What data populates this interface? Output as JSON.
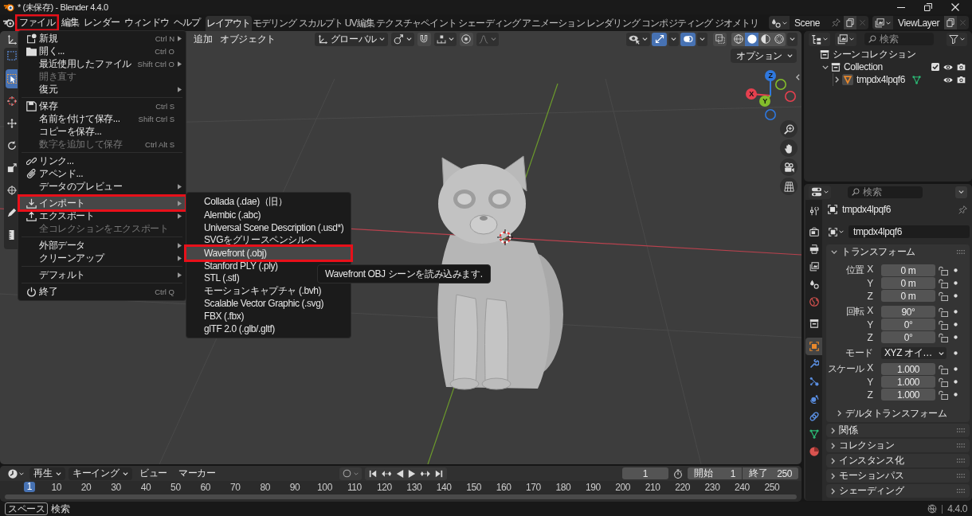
{
  "window": {
    "title": "* (未保存) - Blender 4.4.0"
  },
  "menubar": [
    {
      "label": "ファイル",
      "highlighted": true
    },
    {
      "label": "編集",
      "highlighted": false
    },
    {
      "label": "レンダー",
      "highlighted": false
    },
    {
      "label": "ウィンドウ",
      "highlighted": false
    },
    {
      "label": "ヘルプ",
      "highlighted": false
    }
  ],
  "workspace_tabs": [
    {
      "label": "レイアウト",
      "selected": true
    },
    {
      "label": "モデリング",
      "selected": false
    },
    {
      "label": "スカルプト",
      "selected": false
    },
    {
      "label": "UV編集",
      "selected": false
    },
    {
      "label": "テクスチャペイント",
      "selected": false
    },
    {
      "label": "シェーディング",
      "selected": false
    },
    {
      "label": "アニメーション",
      "selected": false
    },
    {
      "label": "レンダリング",
      "selected": false
    },
    {
      "label": "コンポジティング",
      "selected": false
    },
    {
      "label": "ジオメトリ",
      "selected": false
    }
  ],
  "scene_selector": {
    "value": "Scene"
  },
  "view_layer_selector": {
    "value": "ViewLayer"
  },
  "viewport": {
    "menus": [
      "追加",
      "オブジェクト"
    ],
    "orientation": "グローバル",
    "gizmos": {
      "on": true
    },
    "overlays": {
      "on": true
    },
    "shading_modes": [
      {
        "selected": false
      },
      {
        "selected": true
      },
      {
        "selected": false
      },
      {
        "selected": false
      }
    ],
    "options": "オプション",
    "gizmo_axes": [
      {
        "label": "X",
        "color": "#e5404f"
      },
      {
        "label": "Y",
        "color": "#84bd2b"
      },
      {
        "label": "Z",
        "color": "#2f78de"
      }
    ],
    "tools": [
      {
        "selected": true
      },
      {
        "selected": false
      },
      {
        "selected": false
      },
      {
        "selected": false
      },
      {
        "selected": false
      },
      {
        "selected": false
      },
      {
        "selected": false
      },
      {
        "selected": false
      }
    ]
  },
  "file_menu": {
    "sections": [
      [
        {
          "label": "新規",
          "shortcut": "Ctrl N",
          "submenu": true,
          "disabled": false,
          "selected": false,
          "highlighted": false
        },
        {
          "label": "開く...",
          "shortcut": "Ctrl O",
          "submenu": false,
          "disabled": false,
          "selected": false,
          "highlighted": false
        },
        {
          "label": "最近使用したファイル",
          "shortcut": "Shift Ctrl O",
          "submenu": true,
          "disabled": false,
          "selected": false,
          "highlighted": false
        },
        {
          "label": "開き直す",
          "submenu": false,
          "disabled": true,
          "selected": false,
          "highlighted": false
        },
        {
          "label": "復元",
          "submenu": true,
          "disabled": false,
          "selected": false,
          "highlighted": false
        }
      ],
      [
        {
          "label": "保存",
          "shortcut": "Ctrl S",
          "submenu": false,
          "disabled": false,
          "selected": false,
          "highlighted": false
        },
        {
          "label": "名前を付けて保存...",
          "shortcut": "Shift Ctrl S",
          "submenu": false,
          "disabled": false,
          "selected": false,
          "highlighted": false
        },
        {
          "label": "コピーを保存...",
          "submenu": false,
          "disabled": false,
          "selected": false,
          "highlighted": false
        },
        {
          "label": "数字を追加して保存",
          "shortcut": "Ctrl Alt S",
          "submenu": false,
          "disabled": true,
          "selected": false,
          "highlighted": false
        }
      ],
      [
        {
          "label": "リンク...",
          "submenu": false,
          "disabled": false,
          "selected": false,
          "highlighted": false
        },
        {
          "label": "アペンド...",
          "submenu": false,
          "disabled": false,
          "selected": false,
          "highlighted": false
        },
        {
          "label": "データのプレビュー",
          "submenu": true,
          "disabled": false,
          "selected": false,
          "highlighted": false
        }
      ],
      [
        {
          "label": "インポート",
          "submenu": true,
          "disabled": false,
          "selected": true,
          "highlighted": true
        },
        {
          "label": "エクスポート",
          "submenu": true,
          "disabled": false,
          "selected": false,
          "highlighted": false
        },
        {
          "label": "全コレクションをエクスポート",
          "submenu": false,
          "disabled": true,
          "selected": false,
          "highlighted": false
        }
      ],
      [
        {
          "label": "外部データ",
          "submenu": true,
          "disabled": false,
          "selected": false,
          "highlighted": false
        },
        {
          "label": "クリーンアップ",
          "submenu": true,
          "disabled": false,
          "selected": false,
          "highlighted": false
        }
      ],
      [
        {
          "label": "デフォルト",
          "submenu": true,
          "disabled": false,
          "selected": false,
          "highlighted": false
        }
      ],
      [
        {
          "label": "終了",
          "shortcut": "Ctrl Q",
          "submenu": false,
          "disabled": false,
          "selected": false,
          "highlighted": false
        }
      ]
    ]
  },
  "import_menu": {
    "items": [
      {
        "label": "Collada (.dae)（旧）",
        "selected": false,
        "highlighted": false
      },
      {
        "label": "Alembic (.abc)",
        "selected": false,
        "highlighted": false
      },
      {
        "label": "Universal Scene Description (.usd*)",
        "selected": false,
        "highlighted": false
      },
      {
        "label": "SVGをグリースペンシルへ",
        "selected": false,
        "highlighted": false
      },
      {
        "label": "Wavefront (.obj)",
        "selected": true,
        "highlighted": true
      },
      {
        "label": "Stanford PLY (.ply)",
        "selected": false,
        "highlighted": false
      },
      {
        "label": "STL (.stl)",
        "selected": false,
        "highlighted": false
      },
      {
        "label": "モーションキャプチャ (.bvh)",
        "selected": false,
        "highlighted": false
      },
      {
        "label": "Scalable Vector Graphic (.svg)",
        "selected": false,
        "highlighted": false
      },
      {
        "label": "FBX (.fbx)",
        "selected": false,
        "highlighted": false
      },
      {
        "label": "glTF 2.0 (.glb/.gltf)",
        "selected": false,
        "highlighted": false
      }
    ]
  },
  "tooltip": {
    "text": "Wavefront OBJ シーンを読み込みます."
  },
  "outliner": {
    "search": {
      "placeholder": "検索"
    },
    "tree": [
      {
        "kind": "scene_collection",
        "label": "シーンコレクション",
        "children": [
          {
            "kind": "collection",
            "label": "Collection",
            "expanded": true,
            "checked": true,
            "children": [
              {
                "kind": "object",
                "label": "tmpdx4lpqf6",
                "expanded": false
              }
            ]
          }
        ]
      }
    ]
  },
  "properties": {
    "search": {
      "placeholder": "検索"
    },
    "tabs": [
      {
        "selected": false
      },
      {
        "selected": false
      },
      {
        "selected": false
      },
      {
        "selected": false
      },
      {
        "selected": false
      },
      {
        "selected": false
      },
      {
        "selected": false
      },
      {
        "selected": true
      },
      {
        "selected": false
      },
      {
        "selected": false
      },
      {
        "selected": false
      },
      {
        "selected": false
      },
      {
        "selected": false
      },
      {
        "selected": false
      }
    ],
    "object_name": "tmpdx4lpqf6",
    "name_field": "tmpdx4lpqf6",
    "panels": [
      {
        "label": "トランスフォーム",
        "expanded": true,
        "rows": [
          {
            "kind": "number",
            "label": "位置",
            "axis": "X",
            "value": "0 m",
            "locked": false
          },
          {
            "kind": "number",
            "axis": "Y",
            "value": "0 m",
            "locked": false
          },
          {
            "kind": "number",
            "axis": "Z",
            "value": "0 m",
            "locked": false
          },
          {
            "kind": "number",
            "label": "回転",
            "axis": "X",
            "value": "90°",
            "locked": false
          },
          {
            "kind": "number",
            "axis": "Y",
            "value": "0°",
            "locked": false
          },
          {
            "kind": "number",
            "axis": "Z",
            "value": "0°",
            "locked": false
          },
          {
            "kind": "dropdown",
            "label": "モード",
            "value": "XYZ オイ…"
          },
          {
            "kind": "number",
            "label": "スケール",
            "axis": "X",
            "value": "1.000",
            "locked": false
          },
          {
            "kind": "number",
            "axis": "Y",
            "value": "1.000",
            "locked": false
          },
          {
            "kind": "number",
            "axis": "Z",
            "value": "1.000",
            "locked": false
          }
        ],
        "subpanels": [
          {
            "label": "デルタトランスフォーム",
            "expanded": false
          }
        ]
      },
      {
        "label": "関係",
        "expanded": false
      },
      {
        "label": "コレクション",
        "expanded": false
      },
      {
        "label": "インスタンス化",
        "expanded": false
      },
      {
        "label": "モーションパス",
        "expanded": false
      },
      {
        "label": "シェーディング",
        "expanded": false
      }
    ]
  },
  "timeline": {
    "menus": [
      {
        "label": "再生",
        "dropdown": true
      },
      {
        "label": "キーイング",
        "dropdown": true
      },
      {
        "label": "ビュー",
        "dropdown": false
      },
      {
        "label": "マーカー",
        "dropdown": false
      }
    ],
    "auto_keying": {
      "on": false
    },
    "current_frame": "1",
    "start": {
      "label": "開始",
      "value": "1"
    },
    "end": {
      "label": "終了",
      "value": "250"
    },
    "ruler": [
      {
        "label": "1",
        "selected": true
      },
      {
        "label": "10",
        "selected": false
      },
      {
        "label": "20",
        "selected": false
      },
      {
        "label": "30",
        "selected": false
      },
      {
        "label": "40",
        "selected": false
      },
      {
        "label": "50",
        "selected": false
      },
      {
        "label": "60",
        "selected": false
      },
      {
        "label": "70",
        "selected": false
      },
      {
        "label": "80",
        "selected": false
      },
      {
        "label": "90",
        "selected": false
      },
      {
        "label": "100",
        "selected": false
      },
      {
        "label": "110",
        "selected": false
      },
      {
        "label": "120",
        "selected": false
      },
      {
        "label": "130",
        "selected": false
      },
      {
        "label": "140",
        "selected": false
      },
      {
        "label": "150",
        "selected": false
      },
      {
        "label": "160",
        "selected": false
      },
      {
        "label": "170",
        "selected": false
      },
      {
        "label": "180",
        "selected": false
      },
      {
        "label": "190",
        "selected": false
      },
      {
        "label": "200",
        "selected": false
      },
      {
        "label": "210",
        "selected": false
      },
      {
        "label": "220",
        "selected": false
      },
      {
        "label": "230",
        "selected": false
      },
      {
        "label": "240",
        "selected": false
      },
      {
        "label": "250",
        "selected": false
      }
    ]
  },
  "status_bar": {
    "key": "スペース",
    "action": "検索",
    "version": "4.4.0"
  }
}
